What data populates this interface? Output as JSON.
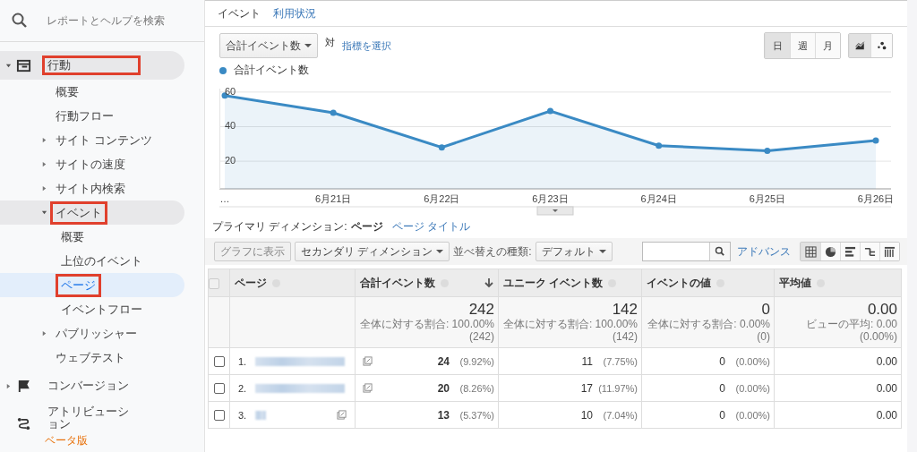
{
  "sidebar": {
    "search": {
      "placeholder": "レポートとヘルプを検索"
    },
    "items": [
      {
        "label": "行動",
        "kind": "window",
        "expanded": true,
        "highlighted": true,
        "selected": false,
        "children": [
          {
            "label": "概要",
            "selected": false,
            "highlighted": false
          },
          {
            "label": "行動フロー",
            "selected": false,
            "highlighted": false
          },
          {
            "label": "サイト コンテンツ",
            "expanded": false,
            "selected": false,
            "highlighted": false
          },
          {
            "label": "サイトの速度",
            "expanded": false,
            "selected": false,
            "highlighted": false
          },
          {
            "label": "サイト内検索",
            "expanded": false,
            "selected": false,
            "highlighted": false
          },
          {
            "label": "イベント",
            "expanded": true,
            "selected": false,
            "highlighted": true,
            "children": [
              {
                "label": "概要",
                "selected": false,
                "highlighted": false
              },
              {
                "label": "上位のイベント",
                "selected": false,
                "highlighted": false
              },
              {
                "label": "ページ",
                "selected": true,
                "highlighted": true
              },
              {
                "label": "イベントフロー",
                "selected": false,
                "highlighted": false
              }
            ]
          },
          {
            "label": "パブリッシャー",
            "expanded": false,
            "selected": false,
            "highlighted": false
          },
          {
            "label": "ウェブテスト",
            "selected": false,
            "highlighted": false
          }
        ]
      },
      {
        "label": "コンバージョン",
        "kind": "flag",
        "expanded": false,
        "selected": false,
        "highlighted": false
      },
      {
        "label": "アトリビューション",
        "kind": "route",
        "badge": "ベータ版",
        "selected": false,
        "highlighted": false
      }
    ]
  },
  "tabs": [
    {
      "label": "イベント",
      "selected": true
    },
    {
      "label": "利用状況",
      "selected": false
    }
  ],
  "metric_select": {
    "value": "合計イベント数",
    "versus": "対",
    "link": "指標を選択"
  },
  "period_buttons": [
    {
      "label": "日",
      "selected": true
    },
    {
      "label": "週",
      "selected": false
    },
    {
      "label": "月",
      "selected": false
    }
  ],
  "chart_type_buttons": [
    {
      "kind": "line",
      "selected": true
    },
    {
      "kind": "motion",
      "selected": false
    }
  ],
  "chart": {
    "chart_data": {
      "type": "area",
      "grid": true,
      "categories": [
        "…",
        "6月21日",
        "6月22日",
        "6月23日",
        "6月24日",
        "6月25日",
        "6月26日"
      ],
      "series": [
        {
          "name": "合計イベント数",
          "color": "#3a8ac4",
          "marker": "circle",
          "values": [
            58,
            48,
            28,
            49,
            29,
            26,
            32
          ]
        }
      ],
      "ylim": [
        4,
        62
      ],
      "yticks": [
        20,
        40,
        60
      ]
    }
  },
  "primary_dimension": {
    "label": "プライマリ ディメンション:",
    "options": [
      {
        "label": "ページ",
        "selected": true
      },
      {
        "label": "ページ タイトル",
        "selected": false
      }
    ]
  },
  "toolbar": {
    "plot_button": {
      "label": "グラフに表示",
      "disabled": true
    },
    "secondary": "セカンダリ ディメンション",
    "sort_label": "並べ替えの種類:",
    "sort_value": "デフォルト",
    "advanced": "アドバンス",
    "views": [
      {
        "kind": "table",
        "selected": true
      },
      {
        "kind": "pie",
        "selected": false
      },
      {
        "kind": "bars",
        "selected": false
      },
      {
        "kind": "compare",
        "selected": false
      },
      {
        "kind": "pivot",
        "selected": false
      }
    ]
  },
  "table": {
    "select_all_checked": false,
    "columns": [
      {
        "label": "ページ",
        "sorted": false
      },
      {
        "label": "合計イベント数",
        "sorted": true
      },
      {
        "label": "ユニーク イベント数",
        "sorted": false
      },
      {
        "label": "イベントの値",
        "sorted": false
      },
      {
        "label": "平均値",
        "sorted": false
      }
    ],
    "summary": [
      {
        "value": "242",
        "line1": "全体に対する割合: 100.00%",
        "line2": "(242)"
      },
      {
        "value": "142",
        "line1": "全体に対する割合: 100.00%",
        "line2": "(142)"
      },
      {
        "value": "0",
        "line1": "全体に対する割合: 0.00%",
        "line2": "(0)"
      },
      {
        "value": "0.00",
        "line1": "ビューの平均: 0.00",
        "line2": "(0.00%)"
      }
    ],
    "rows": [
      {
        "checked": false,
        "cells": [
          {
            "value": "1."
          },
          {
            "value": "24",
            "pct": "(9.92%)"
          },
          {
            "value": "11",
            "pct": "(7.75%)"
          },
          {
            "value": "0",
            "pct": "(0.00%)"
          },
          {
            "value": "0.00"
          }
        ]
      },
      {
        "checked": false,
        "cells": [
          {
            "value": "2."
          },
          {
            "value": "20",
            "pct": "(8.26%)"
          },
          {
            "value": "17",
            "pct": "(11.97%)"
          },
          {
            "value": "0",
            "pct": "(0.00%)"
          },
          {
            "value": "0.00"
          }
        ]
      },
      {
        "checked": false,
        "cells": [
          {
            "value": "3."
          },
          {
            "value": "13",
            "pct": "(5.37%)"
          },
          {
            "value": "10",
            "pct": "(7.04%)"
          },
          {
            "value": "0",
            "pct": "(0.00%)"
          },
          {
            "value": "0.00"
          }
        ]
      }
    ]
  }
}
